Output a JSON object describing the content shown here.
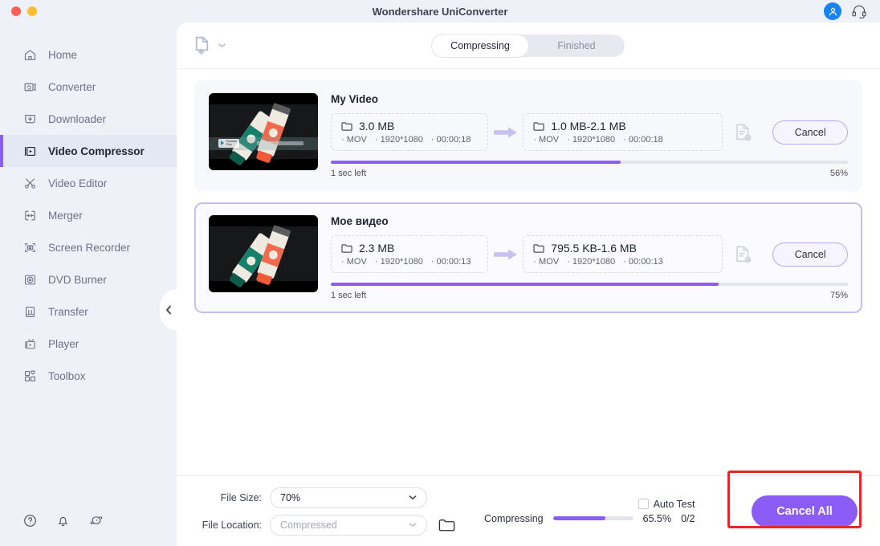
{
  "window": {
    "title": "Wondershare UniConverter",
    "controls": [
      "close",
      "minimize"
    ],
    "account_icon": "user-avatar-icon",
    "support_icon": "headset-icon"
  },
  "sidebar": {
    "items": [
      {
        "label": "Home",
        "icon": "home-icon",
        "active": false
      },
      {
        "label": "Converter",
        "icon": "converter-icon",
        "active": false
      },
      {
        "label": "Downloader",
        "icon": "download-icon",
        "active": false
      },
      {
        "label": "Video Compressor",
        "icon": "video-compressor-icon",
        "active": true
      },
      {
        "label": "Video Editor",
        "icon": "scissors-icon",
        "active": false
      },
      {
        "label": "Merger",
        "icon": "merger-icon",
        "active": false
      },
      {
        "label": "Screen Recorder",
        "icon": "screen-recorder-icon",
        "active": false
      },
      {
        "label": "DVD Burner",
        "icon": "disc-icon",
        "active": false
      },
      {
        "label": "Transfer",
        "icon": "transfer-icon",
        "active": false
      },
      {
        "label": "Player",
        "icon": "player-icon",
        "active": false
      },
      {
        "label": "Toolbox",
        "icon": "toolbox-icon",
        "active": false
      }
    ],
    "footer_icons": [
      "help-icon",
      "bell-icon",
      "feedback-icon"
    ],
    "collapse_icon": "chevron-left-icon"
  },
  "toolbar": {
    "add_file_icon": "add-file-icon",
    "add_file_chevron": "chevron-down-icon",
    "tabs": [
      {
        "label": "Compressing",
        "active": true
      },
      {
        "label": "Finished",
        "active": false
      }
    ]
  },
  "tasks": [
    {
      "title": "My Video",
      "selected": false,
      "source": {
        "size": "3.0 MB",
        "format": "MOV",
        "resolution": "1920*1080",
        "duration": "00:00:18"
      },
      "target": {
        "size": "1.0 MB-2.1 MB",
        "format": "MOV",
        "resolution": "1920*1080",
        "duration": "00:00:18"
      },
      "settings_icon": "file-settings-icon",
      "action_label": "Cancel",
      "time_left": "1 sec left",
      "percent_label": "56%",
      "percent": 56
    },
    {
      "title": "Мое видео",
      "selected": true,
      "source": {
        "size": "2.3 MB",
        "format": "MOV",
        "resolution": "1920*1080",
        "duration": "00:00:13"
      },
      "target": {
        "size": "795.5 KB-1.6 MB",
        "format": "MOV",
        "resolution": "1920*1080",
        "duration": "00:00:13"
      },
      "settings_icon": "file-settings-icon",
      "action_label": "Cancel",
      "time_left": "1 sec left",
      "percent_label": "75%",
      "percent": 75
    }
  ],
  "footer": {
    "file_size_label": "File Size:",
    "file_size_value": "70%",
    "file_location_label": "File Location:",
    "file_location_value": "Compressed",
    "folder_icon": "folder-icon",
    "auto_test_label": "Auto Test",
    "auto_test_checked": false,
    "status_label": "Compressing",
    "overall_percent_label": "65.5%",
    "overall_percent": 65.5,
    "count_label": "0/2",
    "cancel_all_label": "Cancel All"
  },
  "colors": {
    "accent": "#8b5cf6",
    "sidebar_bg": "#eef1f8",
    "card_bg": "#f7f8fc",
    "selected_border": "#c3c0f0",
    "highlight": "#e8252c",
    "avatar_blue": "#1a82f7"
  }
}
